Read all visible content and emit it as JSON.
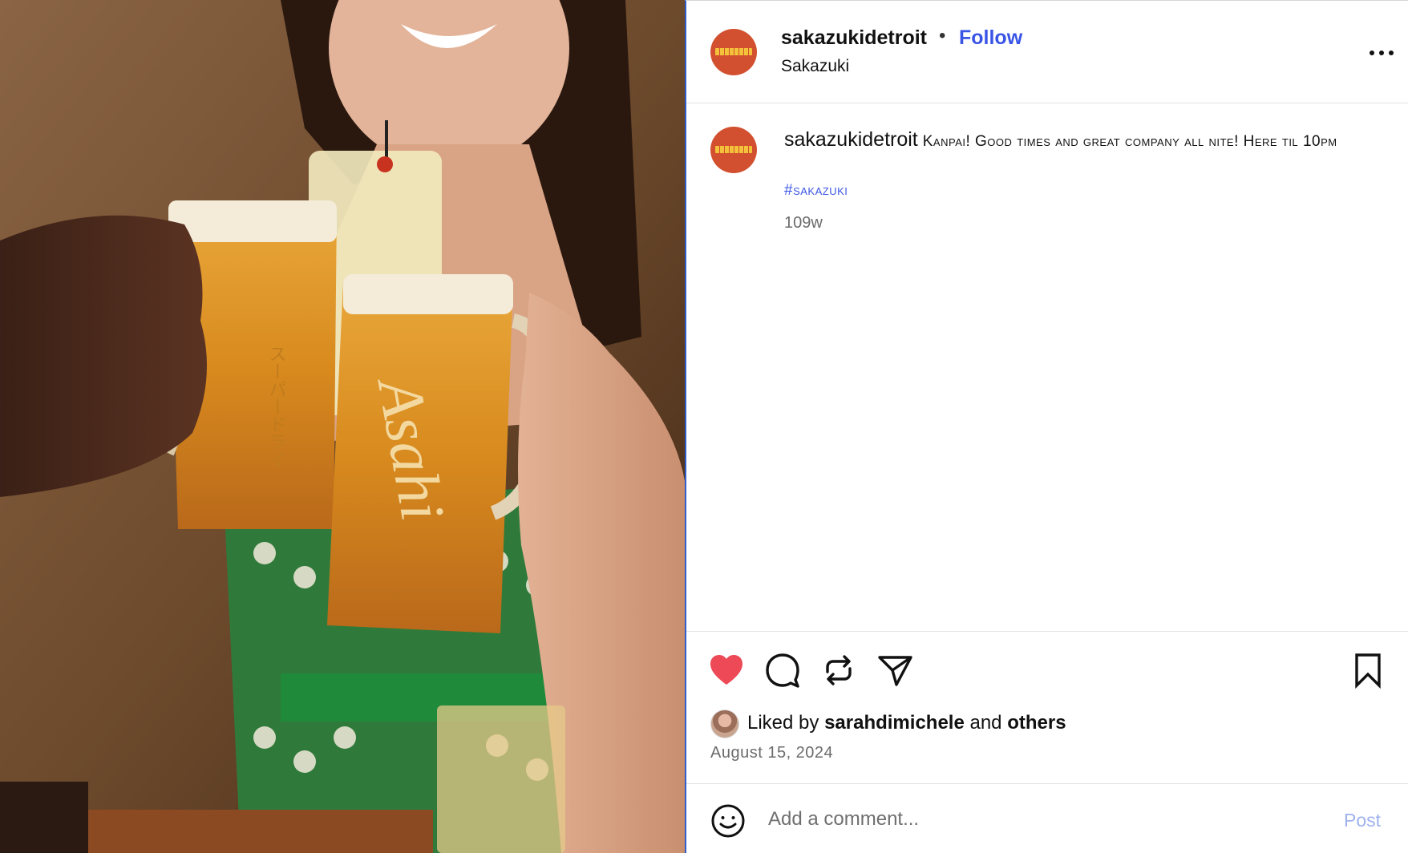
{
  "post": {
    "username": "sakazukidetroit",
    "separator": "•",
    "follow_label": "Follow",
    "location": "Sakazuki",
    "more_icon": "more-horizontal-icon"
  },
  "caption": {
    "username": "sakazukidetroit",
    "text": "Kanpai! Good times and great company all nite! Here til 10pm",
    "hashtag": "#sakazuki",
    "time_ago": "109w"
  },
  "actions": {
    "like_icon": "heart-filled-icon",
    "comment_icon": "comment-icon",
    "repost_icon": "repost-icon",
    "share_icon": "share-icon",
    "save_icon": "bookmark-icon",
    "like_color": "#ed4956"
  },
  "likes": {
    "prefix": "Liked by ",
    "user": "sarahdimichele",
    "middle": " and ",
    "others": "others"
  },
  "date": "August 15, 2024",
  "comment": {
    "placeholder": "Add a comment...",
    "post_label": "Post"
  },
  "colors": {
    "accent": "#3a55e6",
    "avatar_bg": "#d2502f",
    "post_disabled": "#9fb2ee",
    "divider": "#e3e3e3"
  }
}
